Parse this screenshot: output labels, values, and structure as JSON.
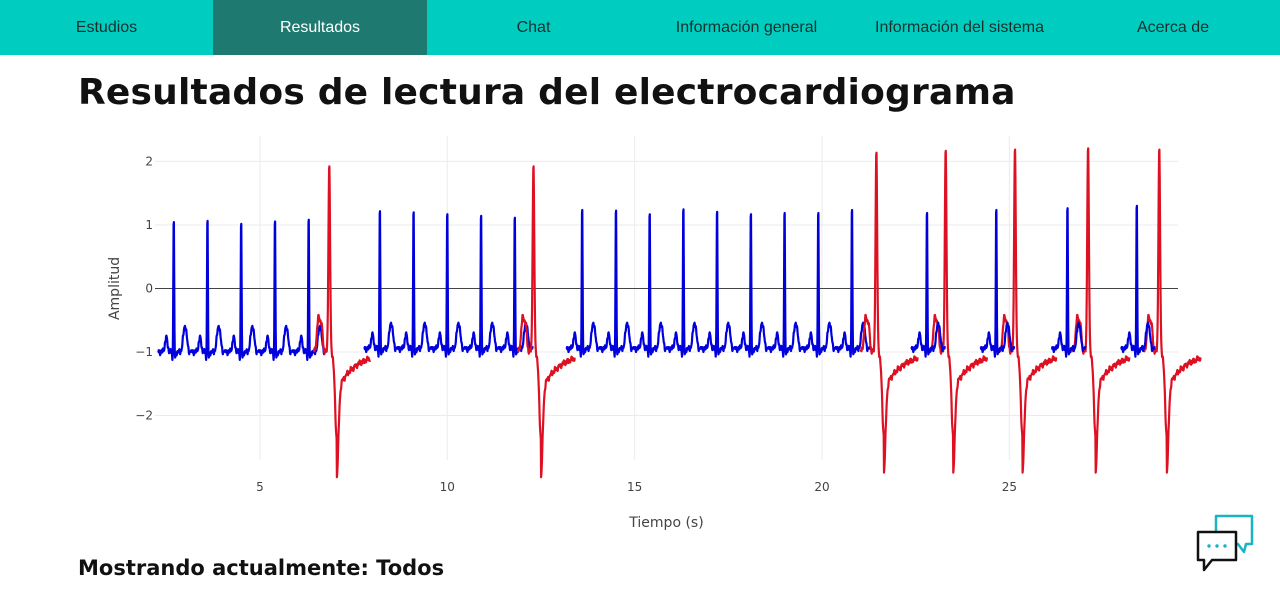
{
  "nav": {
    "items": [
      {
        "label": "Estudios",
        "active": false
      },
      {
        "label": "Resultados",
        "active": true
      },
      {
        "label": "Chat",
        "active": false
      },
      {
        "label": "Información general",
        "active": false
      },
      {
        "label": "Información del sistema",
        "active": false
      },
      {
        "label": "Acerca de",
        "active": false
      }
    ]
  },
  "page": {
    "title": "Resultados de lectura del electrocardiograma",
    "status_prefix": "Mostrando actualmente:",
    "status_value": "Todos"
  },
  "chat_widget": {
    "icon": "chat-bubbles-icon"
  },
  "chart_data": {
    "type": "line",
    "title": "",
    "xlabel": "Tiempo (s)",
    "ylabel": "Amplitud",
    "xlim": [
      2.2,
      29.5
    ],
    "ylim": [
      -2.7,
      2.4
    ],
    "x_ticks": [
      5,
      10,
      15,
      20,
      25
    ],
    "y_ticks": [
      2,
      1,
      0,
      -1,
      -2
    ],
    "y_tick_labels": [
      "2",
      "1",
      "0",
      "−1",
      "−2"
    ],
    "grid": true,
    "legend": "none",
    "colors": {
      "normal": "#0000dd",
      "abnormal": "#dd1122"
    },
    "series": [
      {
        "class": "normal",
        "beats_at": [
          2.7,
          3.6,
          4.5,
          5.4,
          6.3
        ],
        "r_peak": [
          1.15,
          1.17,
          1.12,
          1.16,
          1.19
        ],
        "baseline": -1.0
      },
      {
        "class": "abnormal",
        "beats_at": [
          6.85
        ],
        "r_peak": [
          1.93
        ],
        "s_min": -2.35
      },
      {
        "class": "normal",
        "beats_at": [
          8.2,
          9.1,
          10.0,
          10.9,
          11.8
        ],
        "r_peak": [
          1.33,
          1.31,
          1.28,
          1.25,
          1.22
        ],
        "baseline": -0.95
      },
      {
        "class": "abnormal",
        "beats_at": [
          12.3
        ],
        "r_peak": [
          1.93
        ],
        "s_min": -2.35
      },
      {
        "class": "normal",
        "beats_at": [
          13.6,
          14.5,
          15.4,
          16.3,
          17.2,
          18.1,
          19.0,
          19.9,
          20.8
        ],
        "r_peak": [
          1.35,
          1.34,
          1.28,
          1.36,
          1.32,
          1.28,
          1.3,
          1.3,
          1.35
        ],
        "baseline": -0.95
      },
      {
        "class": "abnormal",
        "beats_at": [
          21.45,
          23.3,
          25.15,
          27.1,
          29.0
        ],
        "r_peak": [
          2.15,
          2.18,
          2.2,
          2.22,
          2.2
        ],
        "s_min": -2.3
      },
      {
        "class": "normal",
        "beats_at": [
          22.8,
          24.65,
          26.55,
          28.4
        ],
        "r_peak": [
          1.3,
          1.35,
          1.38,
          1.42
        ],
        "baseline": -0.95
      }
    ]
  }
}
